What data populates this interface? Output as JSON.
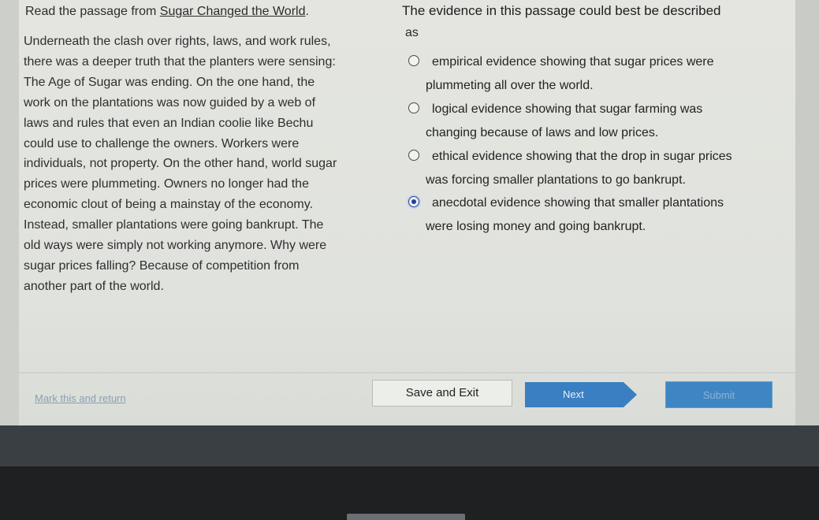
{
  "passage": {
    "intro": "Read the passage from ",
    "title": "Sugar Changed the World",
    "intro_end": ".",
    "lines": [
      "Underneath the clash over rights, laws, and work rules,",
      "there was a deeper truth that the planters were sensing:",
      "The Age of Sugar was ending. On the one hand, the",
      "work on the plantations was now guided by a web of",
      "laws and rules that even an Indian coolie like Bechu",
      "could use to challenge the owners. Workers were",
      "individuals, not property. On the other hand, world sugar",
      "prices were plummeting. Owners no longer had the",
      "economic clout of being a mainstay of the economy.",
      "Instead, smaller plantations were going bankrupt. The",
      "old ways were simply not working anymore. Why were",
      "sugar prices falling? Because of competition from",
      "another part of the world."
    ]
  },
  "question": {
    "text": "The evidence in this passage could best be described",
    "text_end": "as"
  },
  "options": [
    {
      "line1": "empirical evidence showing that sugar prices were",
      "line2": "plummeting all over the world.",
      "selected": false
    },
    {
      "line1": "logical evidence showing that sugar farming was",
      "line2": "changing because of laws and low prices.",
      "selected": false
    },
    {
      "line1": "ethical evidence showing that the drop in sugar prices",
      "line2": "was forcing smaller plantations to go bankrupt.",
      "selected": false
    },
    {
      "line1": "anecdotal evidence showing that smaller plantations",
      "line2": "were losing money and going bankrupt.",
      "selected": true
    }
  ],
  "footer": {
    "mark_label": "Mark this and return",
    "save_label": "Save and Exit",
    "next_label": "Next",
    "submit_label": "Submit"
  },
  "colors": {
    "accent": "#3a7fc1",
    "selected_radio": "#1f3f9a"
  }
}
